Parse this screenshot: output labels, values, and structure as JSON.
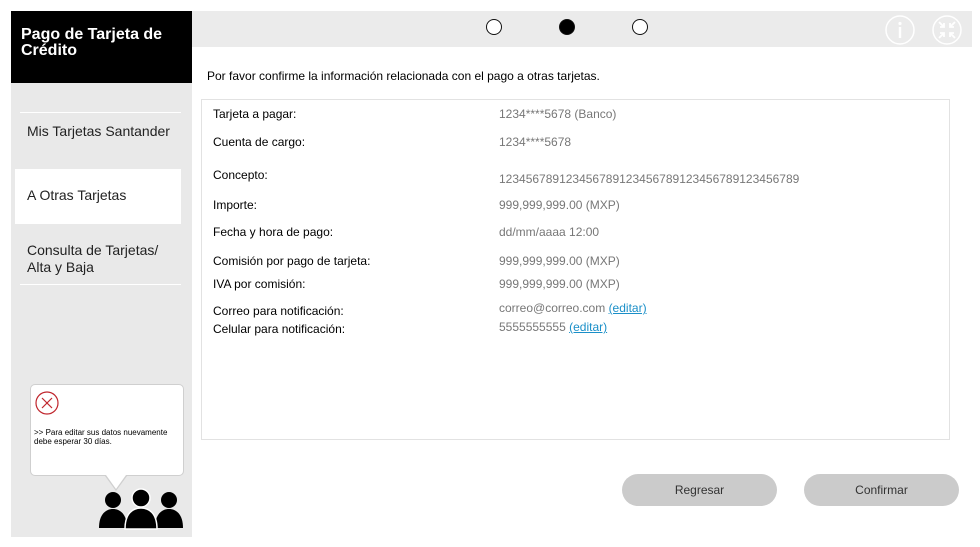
{
  "app": {
    "title": "Pago de Tarjeta de Crédito"
  },
  "sidebar": {
    "items": [
      {
        "label": "Mis Tarjetas Santander",
        "active": false
      },
      {
        "label": "A Otras Tarjetas",
        "active": true
      },
      {
        "label": "Consulta de Tarjetas/ Alta y Baja",
        "active": false
      }
    ]
  },
  "tip": {
    "text": ">> Para editar sus datos nuevamente debe esperar 30 días.",
    "icon": "close-circle-icon"
  },
  "steps": {
    "total": 3,
    "current": 2
  },
  "header_icons": [
    "info-icon",
    "collapse-icon"
  ],
  "main": {
    "intro": "Por favor  confirme la información relacionada con el pago a otras tarjetas.",
    "rows": [
      {
        "label": "Tarjeta a pagar:",
        "value": "1234****5678 (Banco)"
      },
      {
        "label": "Cuenta de cargo:",
        "value": "1234****5678"
      },
      {
        "label": "Concepto:",
        "value": "123456789123456789123456789123456789123456789"
      },
      {
        "label": "Importe:",
        "value": "999,999,999.00 (MXP)"
      },
      {
        "label": "Fecha y hora de pago:",
        "value": "dd/mm/aaaa 12:00"
      },
      {
        "label": "Comisión por pago de tarjeta:",
        "value": "999,999,999.00 (MXP)"
      },
      {
        "label": "IVA por comisión:",
        "value": "999,999,999.00 (MXP)"
      },
      {
        "label": "Correo para notificación:",
        "value": "correo@correo.com",
        "link": "(editar)"
      },
      {
        "label": "Celular para notificación:",
        "value": "5555555555",
        "link": "(editar)"
      }
    ]
  },
  "buttons": {
    "back": "Regresar",
    "confirm": "Confirmar"
  },
  "colors": {
    "brand_bg": "#000000",
    "link": "#1a8fc8",
    "button_bg": "#cbcbcb",
    "sidebar_bg": "#e9e9e9"
  }
}
